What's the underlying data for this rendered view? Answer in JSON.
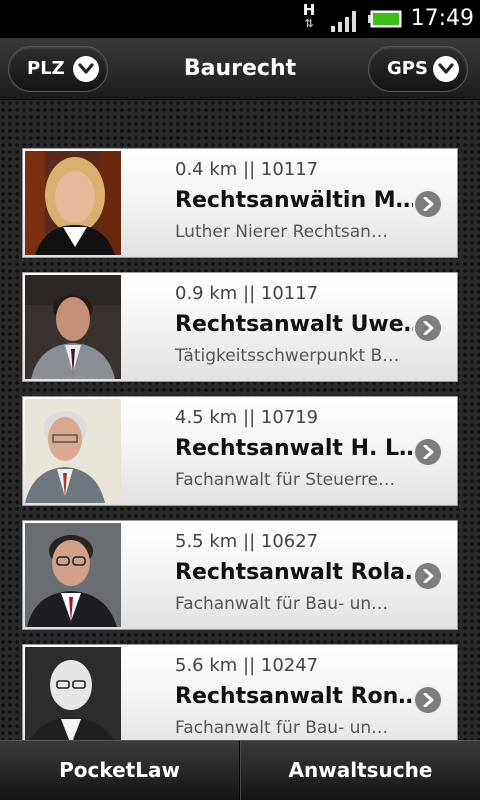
{
  "status_bar": {
    "network_type": "H",
    "time": "17:49",
    "signal_icon": "signal-bars-icon",
    "battery_icon": "battery-icon"
  },
  "header": {
    "title": "Baurecht",
    "left_button": {
      "label": "PLZ",
      "icon": "chevron-down-icon"
    },
    "right_button": {
      "label": "GPS",
      "icon": "chevron-down-icon"
    }
  },
  "lawyers": [
    {
      "meta": "0.4 km || 10117",
      "name": "Rechtsanwältin M…",
      "desc": "Luther Nierer Rechtsan…",
      "photo": {
        "bg": "#5a2a1a",
        "hair": "#d9b070",
        "skin": "#e8b89a",
        "suit": "#111111",
        "shirt": "#ffffff"
      }
    },
    {
      "meta": "0.9 km || 10117",
      "name": "Rechtsanwalt Uwe…",
      "desc": "Tätigkeitsschwerpunkt B…",
      "photo": {
        "bg": "#3a3230",
        "hair": "#2a1a14",
        "skin": "#c49078",
        "suit": "#8a8e94",
        "shirt": "#e8e8ea"
      }
    },
    {
      "meta": "4.5 km || 10719",
      "name": "Rechtsanwalt H. L…",
      "desc": "Fachanwalt für Steuerre…",
      "photo": {
        "bg": "#e8e4da",
        "hair": "#dcdcdc",
        "skin": "#d8a890",
        "suit": "#6e7680",
        "shirt": "#f0f0f0"
      }
    },
    {
      "meta": "5.5 km || 10627",
      "name": "Rechtsanwalt Rola…",
      "desc": "Fachanwalt für Bau- un…",
      "photo": {
        "bg": "#6a6e72",
        "hair": "#2a2420",
        "skin": "#d0a088",
        "suit": "#1c1e24",
        "shirt": "#ffffff"
      }
    },
    {
      "meta": "5.6 km || 10247",
      "name": "Rechtsanwalt Ron…",
      "desc": "Fachanwalt für Bau- un…",
      "photo": {
        "bg": "#2c2c2c",
        "hair": "#e6e6e6",
        "skin": "#e6e6e6",
        "suit": "#202020",
        "shirt": "#f4f4f4"
      }
    }
  ],
  "footer": {
    "tab_left": "PocketLaw",
    "tab_right": "Anwaltsuche"
  }
}
